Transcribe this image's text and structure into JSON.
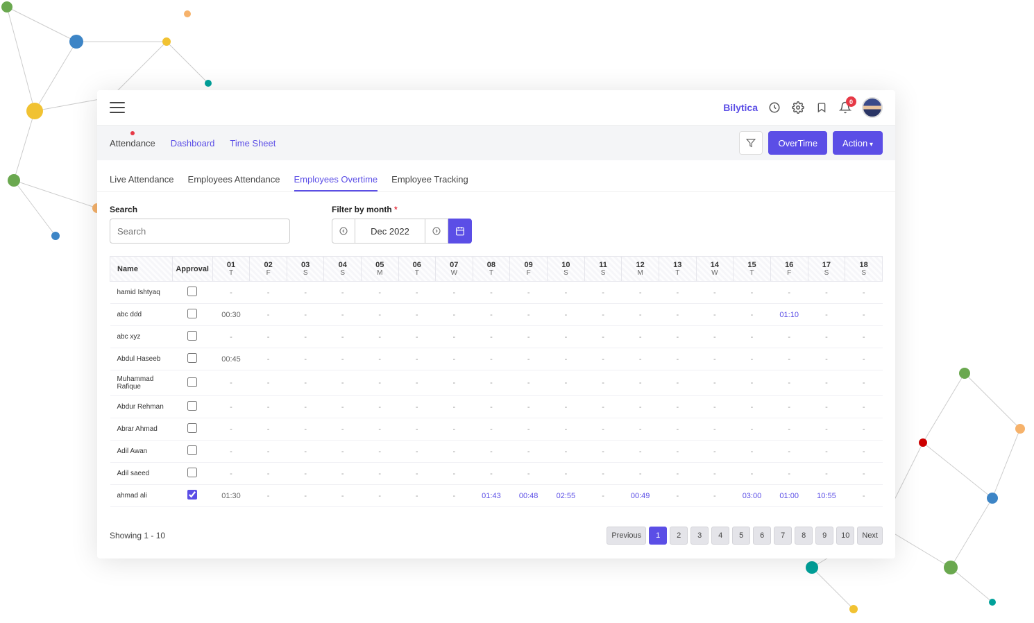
{
  "header": {
    "brand": "Bilytica",
    "notification_count": "0"
  },
  "subnav": {
    "items": [
      {
        "label": "Attendance",
        "active": true
      },
      {
        "label": "Dashboard",
        "active": false
      },
      {
        "label": "Time Sheet",
        "active": false
      }
    ],
    "buttons": {
      "overtime": "OverTime",
      "action": "Action"
    }
  },
  "tabs": [
    {
      "label": "Live Attendance",
      "active": false
    },
    {
      "label": "Employees Attendance",
      "active": false
    },
    {
      "label": "Employees Overtime",
      "active": true
    },
    {
      "label": "Employee Tracking",
      "active": false
    }
  ],
  "filters": {
    "search_label": "Search",
    "search_placeholder": "Search",
    "month_label": "Filter by month ",
    "month_required": "*",
    "month_value": "Dec 2022"
  },
  "table": {
    "name_header": "Name",
    "approval_header": "Approval",
    "days": [
      {
        "d": "01",
        "w": "T"
      },
      {
        "d": "02",
        "w": "F"
      },
      {
        "d": "03",
        "w": "S"
      },
      {
        "d": "04",
        "w": "S"
      },
      {
        "d": "05",
        "w": "M"
      },
      {
        "d": "06",
        "w": "T"
      },
      {
        "d": "07",
        "w": "W"
      },
      {
        "d": "08",
        "w": "T"
      },
      {
        "d": "09",
        "w": "F"
      },
      {
        "d": "10",
        "w": "S"
      },
      {
        "d": "11",
        "w": "S"
      },
      {
        "d": "12",
        "w": "M"
      },
      {
        "d": "13",
        "w": "T"
      },
      {
        "d": "14",
        "w": "W"
      },
      {
        "d": "15",
        "w": "T"
      },
      {
        "d": "16",
        "w": "F"
      },
      {
        "d": "17",
        "w": "S"
      },
      {
        "d": "18",
        "w": "S"
      }
    ],
    "rows": [
      {
        "name": "hamid Ishtyaq",
        "checked": false,
        "cells": [
          "-",
          "-",
          "-",
          "-",
          "-",
          "-",
          "-",
          "-",
          "-",
          "-",
          "-",
          "-",
          "-",
          "-",
          "-",
          "-",
          "-",
          "-"
        ]
      },
      {
        "name": "abc ddd",
        "checked": false,
        "cells": [
          "00:30",
          "-",
          "-",
          "-",
          "-",
          "-",
          "-",
          "-",
          "-",
          "-",
          "-",
          "-",
          "-",
          "-",
          "-",
          {
            "v": "01:10",
            "link": true
          },
          "-",
          "-"
        ]
      },
      {
        "name": "abc xyz",
        "checked": false,
        "cells": [
          "-",
          "-",
          "-",
          "-",
          "-",
          "-",
          "-",
          "-",
          "-",
          "-",
          "-",
          "-",
          "-",
          "-",
          "-",
          "-",
          "-",
          "-"
        ]
      },
      {
        "name": "Abdul Haseeb",
        "checked": false,
        "cells": [
          "00:45",
          "-",
          "-",
          "-",
          "-",
          "-",
          "-",
          "-",
          "-",
          "-",
          "-",
          "-",
          "-",
          "-",
          "-",
          "-",
          "-",
          "-"
        ]
      },
      {
        "name": "Muhammad Rafique",
        "checked": false,
        "cells": [
          "-",
          "-",
          "-",
          "-",
          "-",
          "-",
          "-",
          "-",
          "-",
          "-",
          "-",
          "-",
          "-",
          "-",
          "-",
          "-",
          "-",
          "-"
        ]
      },
      {
        "name": "Abdur Rehman",
        "checked": false,
        "cells": [
          "-",
          "-",
          "-",
          "-",
          "-",
          "-",
          "-",
          "-",
          "-",
          "-",
          "-",
          "-",
          "-",
          "-",
          "-",
          "-",
          "-",
          "-"
        ]
      },
      {
        "name": "Abrar Ahmad",
        "checked": false,
        "cells": [
          "-",
          "-",
          "-",
          "-",
          "-",
          "-",
          "-",
          "-",
          "-",
          "-",
          "-",
          "-",
          "-",
          "-",
          "-",
          "-",
          "-",
          "-"
        ]
      },
      {
        "name": "Adil Awan",
        "checked": false,
        "cells": [
          "-",
          "-",
          "-",
          "-",
          "-",
          "-",
          "-",
          "-",
          "-",
          "-",
          "-",
          "-",
          "-",
          "-",
          "-",
          "-",
          "-",
          "-"
        ]
      },
      {
        "name": "Adil saeed",
        "checked": false,
        "cells": [
          "-",
          "-",
          "-",
          "-",
          "-",
          "-",
          "-",
          "-",
          "-",
          "-",
          "-",
          "-",
          "-",
          "-",
          "-",
          "-",
          "-",
          "-"
        ]
      },
      {
        "name": "ahmad ali",
        "checked": true,
        "cells": [
          "01:30",
          "-",
          "-",
          "-",
          "-",
          "-",
          "-",
          {
            "v": "01:43",
            "link": true
          },
          {
            "v": "00:48",
            "link": true
          },
          {
            "v": "02:55",
            "link": true
          },
          "-",
          {
            "v": "00:49",
            "link": true
          },
          "-",
          "-",
          {
            "v": "03:00",
            "link": true
          },
          {
            "v": "01:00",
            "link": true
          },
          {
            "v": "10:55",
            "link": true
          },
          "-"
        ]
      }
    ]
  },
  "footer": {
    "showing": "Showing 1 - 10",
    "pages": [
      "Previous",
      "1",
      "2",
      "3",
      "4",
      "5",
      "6",
      "7",
      "8",
      "9",
      "10",
      "Next"
    ],
    "active_page": "1"
  }
}
